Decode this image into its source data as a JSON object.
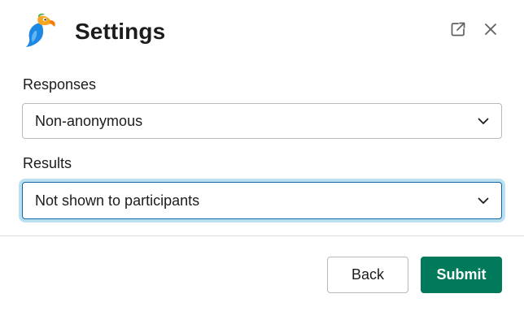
{
  "header": {
    "title": "Settings",
    "logo_icon": "parrot-logo-icon",
    "popout_icon": "external-link-icon",
    "close_icon": "close-icon"
  },
  "fields": {
    "responses": {
      "label": "Responses",
      "value": "Non-anonymous"
    },
    "results": {
      "label": "Results",
      "value": "Not shown to participants"
    }
  },
  "footer": {
    "back_label": "Back",
    "submit_label": "Submit"
  },
  "colors": {
    "primary": "#007a5a",
    "focus_border": "#1264a3",
    "focus_ring": "#1d9bd1"
  }
}
